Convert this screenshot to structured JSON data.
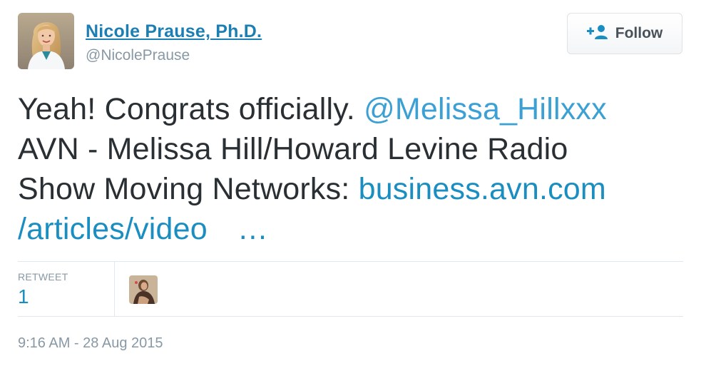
{
  "author": {
    "name": "Nicole Prause, Ph.D.",
    "handle": "@NicolePrause"
  },
  "follow_button": {
    "label": "Follow",
    "icon": "follow-user-plus-icon"
  },
  "tweet": {
    "line1_text": "Yeah! Congrats officially. ",
    "line1_mention": "@Melissa_Hillxxx",
    "line2_text": "AVN - Melissa Hill/Howard Levine Radio",
    "line3_text": "Show Moving Networks: ",
    "line3_link": "business.avn.com",
    "line4_link": "/articles/video",
    "line4_ellipsis": "…"
  },
  "stats": {
    "retweet_label": "RETWEET",
    "retweet_count": "1"
  },
  "timestamp": "9:16 AM - 28 Aug 2015",
  "colors": {
    "link": "#1b8ec1",
    "name": "#1b7fb4",
    "muted": "#8899a6",
    "text": "#292f33"
  }
}
